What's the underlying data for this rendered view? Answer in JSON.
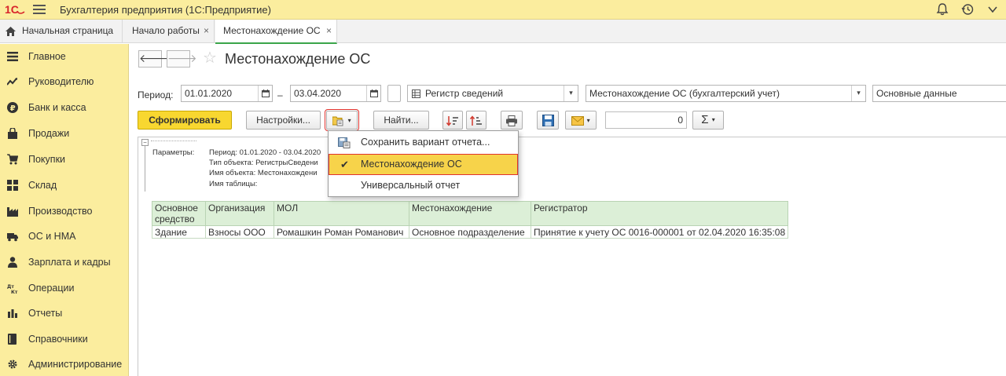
{
  "app": {
    "title": "Бухгалтерия предприятия  (1С:Предприятие)"
  },
  "tabs": [
    {
      "label": "Начальная страница"
    },
    {
      "label": "Начало работы"
    },
    {
      "label": "Местонахождение ОС"
    }
  ],
  "tab_close_glyph": "×",
  "sidebar": {
    "items": [
      {
        "label": "Главное",
        "icon": "menu-lines-icon"
      },
      {
        "label": "Руководителю",
        "icon": "trend-icon"
      },
      {
        "label": "Банк и касса",
        "icon": "ruble-icon"
      },
      {
        "label": "Продажи",
        "icon": "bag-icon"
      },
      {
        "label": "Покупки",
        "icon": "cart-icon"
      },
      {
        "label": "Склад",
        "icon": "grid-icon"
      },
      {
        "label": "Производство",
        "icon": "factory-icon"
      },
      {
        "label": "ОС и НМА",
        "icon": "truck-icon"
      },
      {
        "label": "Зарплата и кадры",
        "icon": "person-icon"
      },
      {
        "label": "Операции",
        "icon": "dt-kt-icon"
      },
      {
        "label": "Отчеты",
        "icon": "bar-chart-icon"
      },
      {
        "label": "Справочники",
        "icon": "book-icon"
      },
      {
        "label": "Администрирование",
        "icon": "gear-icon"
      }
    ]
  },
  "form": {
    "title": "Местонахождение ОС",
    "back_glyph": "🡐",
    "forward_glyph": "🡒",
    "star_glyph": "☆",
    "period_label": "Период:",
    "date_from": "01.01.2020",
    "date_to": "03.04.2020",
    "dash": "–",
    "source_type": "Регистр сведений",
    "source_name": "Местонахождение ОС (бухгалтерский учет)",
    "table_select": "Основные данные",
    "dropdown_arrow": "▾"
  },
  "toolbar": {
    "generate_label": "Сформировать",
    "settings_label": "Настройки...",
    "find_label": "Найти...",
    "counter_value": "0",
    "sum_glyph": "Σ"
  },
  "params": {
    "header": "Параметры:",
    "lines": [
      "Период: 01.01.2020 - 03.04.2020",
      "Тип объекта: РегистрыСведени",
      "Имя объекта: Местонахождени",
      "Имя таблицы:"
    ]
  },
  "table": {
    "headers": [
      "Основное\nсредство",
      "Организация",
      "МОЛ",
      "Местонахождение",
      "Регистратор"
    ],
    "rows": [
      [
        "Здание",
        "Взносы ООО",
        "Ромашкин Роман Романович",
        "Основное подразделение",
        "Принятие к учету ОС 0016-000001 от 02.04.2020 16:35:08"
      ]
    ]
  },
  "popup": {
    "items": [
      {
        "label": "Сохранить вариант отчета..."
      },
      {
        "label": "Местонахождение ОС"
      },
      {
        "label": "Универсальный отчет"
      }
    ],
    "check_glyph": "✔"
  },
  "colors": {
    "panel_yellow": "#fbed9e",
    "primary_button": "#f8d730",
    "table_header": "#dcefd7",
    "highlight_outline": "#e0322d",
    "active_tab_accent": "#3aa54a"
  }
}
